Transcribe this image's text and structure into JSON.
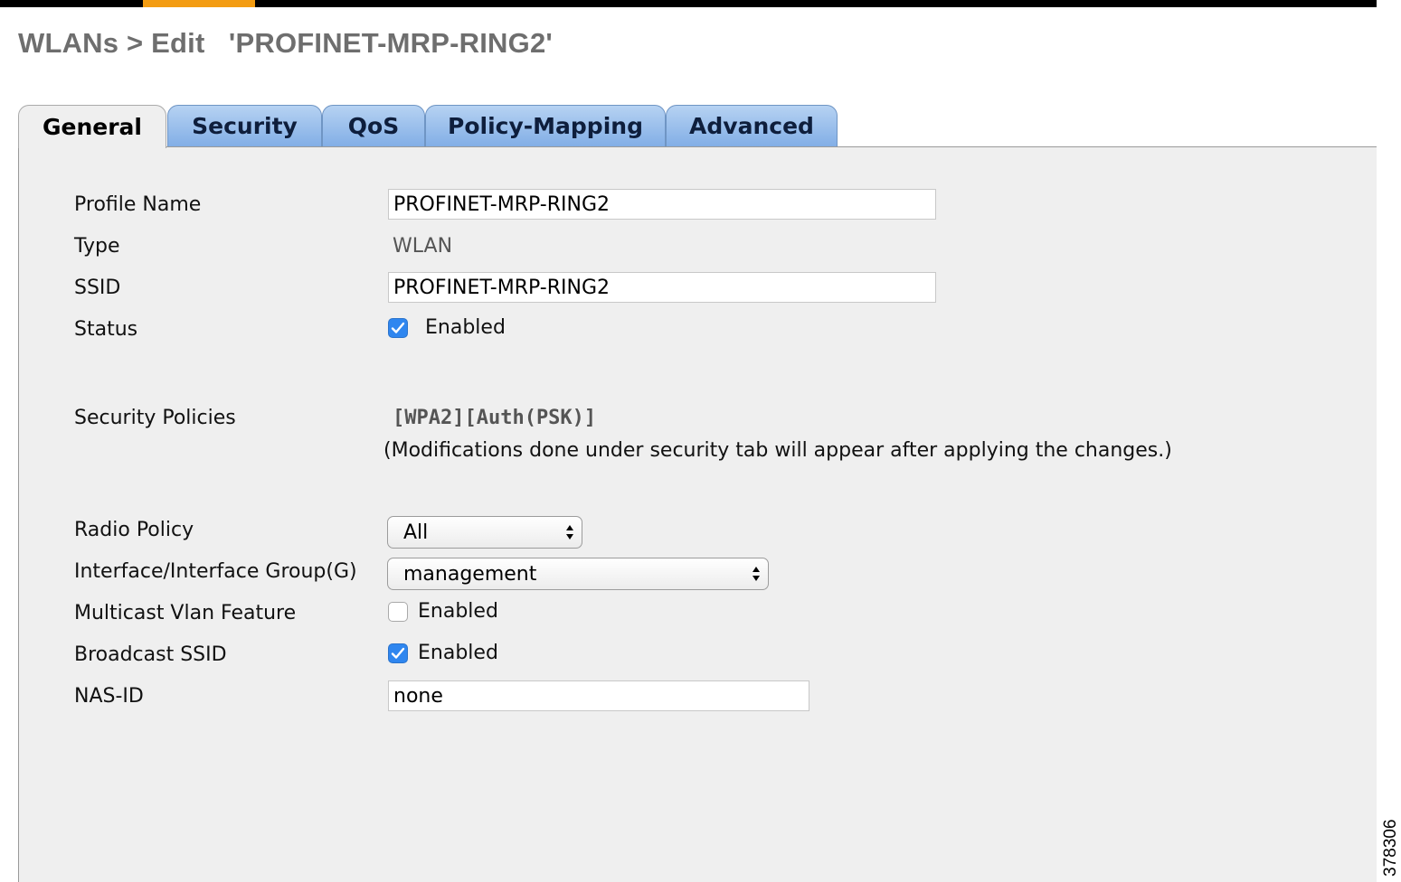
{
  "header": {
    "title": "WLANs > Edit   'PROFINET-MRP-RING2'",
    "accent_color": "#f39c12"
  },
  "tabs": [
    {
      "label": "General",
      "active": true
    },
    {
      "label": "Security",
      "active": false
    },
    {
      "label": "QoS",
      "active": false
    },
    {
      "label": "Policy-Mapping",
      "active": false
    },
    {
      "label": "Advanced",
      "active": false
    }
  ],
  "form": {
    "profile_name": {
      "label": "Profile Name",
      "value": "PROFINET-MRP-RING2"
    },
    "type": {
      "label": "Type",
      "value": "WLAN"
    },
    "ssid": {
      "label": "SSID",
      "value": "PROFINET-MRP-RING2"
    },
    "status": {
      "label": "Status",
      "checkbox_label": "Enabled",
      "checked": true
    },
    "security_policies": {
      "label": "Security Policies",
      "value": "[WPA2][Auth(PSK)]",
      "note": "(Modifications done under security tab will appear after applying the changes.)"
    },
    "radio_policy": {
      "label": "Radio Policy",
      "value": "All"
    },
    "interface": {
      "label": "Interface/Interface Group(G)",
      "value": "management"
    },
    "multicast_vlan": {
      "label": "Multicast Vlan Feature",
      "checkbox_label": "Enabled",
      "checked": false
    },
    "broadcast_ssid": {
      "label": "Broadcast SSID",
      "checkbox_label": "Enabled",
      "checked": true
    },
    "nas_id": {
      "label": "NAS-ID",
      "value": "none"
    }
  },
  "figure_id": "378306",
  "colors": {
    "checkbox_checked": "#2f86ef",
    "tab_blue": "#9cc2ef",
    "panel_bg": "#efefef"
  }
}
